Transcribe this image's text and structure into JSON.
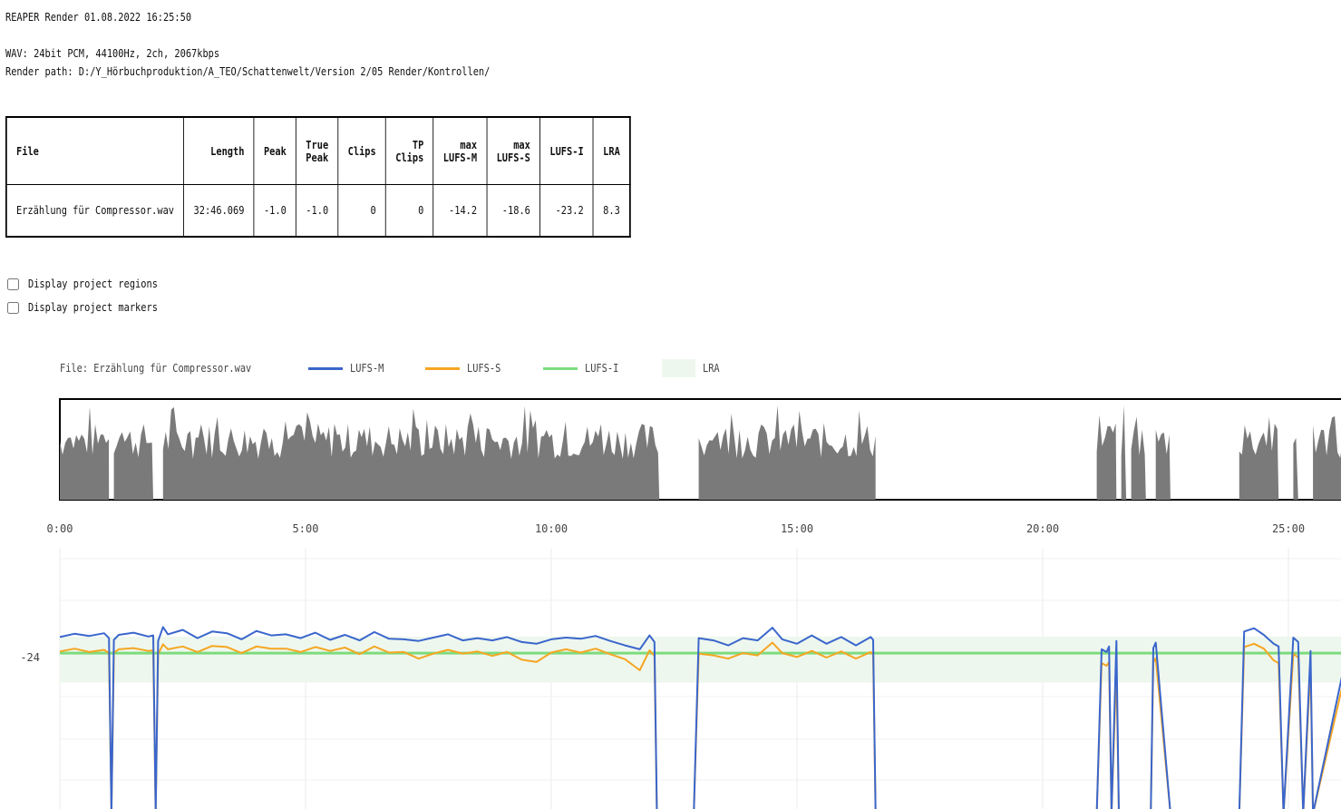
{
  "header": {
    "title": "REAPER Render 01.08.2022 16:25:50",
    "wav_info": "WAV: 24bit PCM, 44100Hz, 2ch, 2067kbps",
    "render_path": "Render path: D:/Y_Hörbuchproduktion/A_TEO/Schattenwelt/Version 2/05 Render/Kontrollen/"
  },
  "table": {
    "headers": [
      "File",
      "Length",
      "Peak",
      "True\nPeak",
      "Clips",
      "TP\nClips",
      "max\nLUFS-M",
      "max\nLUFS-S",
      "LUFS-I",
      "LRA"
    ],
    "rows": [
      [
        "Erzählung für Compressor.wav",
        "32:46.069",
        "-1.0",
        "-1.0",
        "0",
        "0",
        "-14.2",
        "-18.6",
        "-23.2",
        "8.3"
      ]
    ]
  },
  "options": {
    "regions_label": "Display project regions",
    "regions_checked": false,
    "markers_label": "Display project markers",
    "markers_checked": false
  },
  "legend": {
    "file_label": "File: Erzählung für Compressor.wav",
    "lufs_m": "LUFS-M",
    "lufs_s": "LUFS-S",
    "lufs_i": "LUFS-I",
    "lra": "LRA"
  },
  "colors": {
    "lufs_m": "#3a66cc",
    "lufs_s": "#f5a623",
    "lufs_i": "#7ddc7d",
    "lra": "#eef7ee",
    "waveform": "#7a7a7a"
  },
  "chart_data": {
    "type": "line",
    "x_unit": "minutes",
    "xlim": [
      0,
      26.2
    ],
    "x_ticks": [
      "0:00",
      "5:00",
      "10:00",
      "15:00",
      "20:00",
      "25:00"
    ],
    "x_tick_values": [
      0,
      5,
      10,
      15,
      20,
      25
    ],
    "y_ticks": [
      "-24"
    ],
    "y_tick_values": [
      -24
    ],
    "ylim": [
      -40,
      -16
    ],
    "lufs_i": -23.2,
    "lra_range": [
      -28.5,
      -20.2
    ],
    "waveform_segments": [
      [
        0,
        1.0
      ],
      [
        1.1,
        1.9
      ],
      [
        2.1,
        12.2
      ],
      [
        13.0,
        16.6
      ],
      [
        21.1,
        21.5
      ],
      [
        21.6,
        21.7
      ],
      [
        21.8,
        22.1
      ],
      [
        22.3,
        22.6
      ],
      [
        24.0,
        24.8
      ],
      [
        25.1,
        25.2
      ],
      [
        25.5,
        26.2
      ]
    ],
    "series": [
      {
        "name": "LUFS-M",
        "x": [
          0,
          0.3,
          0.6,
          0.9,
          1.0,
          1.05,
          1.1,
          1.2,
          1.5,
          1.8,
          1.9,
          1.95,
          2.0,
          2.1,
          2.2,
          2.5,
          2.8,
          3.1,
          3.4,
          3.7,
          4.0,
          4.3,
          4.6,
          4.9,
          5.2,
          5.5,
          5.8,
          6.1,
          6.4,
          6.7,
          7.0,
          7.3,
          7.6,
          7.9,
          8.2,
          8.5,
          8.8,
          9.1,
          9.4,
          9.7,
          10.0,
          10.3,
          10.6,
          10.9,
          11.2,
          11.5,
          11.8,
          12.0,
          12.1,
          12.15,
          12.2,
          12.9,
          13.0,
          13.3,
          13.6,
          13.9,
          14.2,
          14.5,
          14.7,
          15.0,
          15.3,
          15.6,
          15.9,
          16.2,
          16.5,
          16.55,
          16.6,
          21.1,
          21.2,
          21.3,
          21.35,
          21.4,
          21.5,
          21.55,
          22.2,
          22.25,
          22.3,
          22.6,
          22.65,
          24.0,
          24.1,
          24.3,
          24.5,
          24.7,
          24.8,
          24.9,
          25.1,
          25.2,
          25.3,
          25.45,
          25.5,
          26.2
        ],
        "y": [
          -20.3,
          -19.7,
          -20.1,
          -19.6,
          -20.5,
          -35,
          -20.8,
          -19.9,
          -19.5,
          -20.2,
          -20.0,
          -35,
          -21.0,
          -18.5,
          -19.8,
          -19.0,
          -20.5,
          -19.3,
          -19.6,
          -20.7,
          -19.2,
          -20.0,
          -19.8,
          -20.5,
          -19.5,
          -20.8,
          -19.9,
          -20.9,
          -19.4,
          -20.6,
          -20.7,
          -21.0,
          -20.4,
          -19.8,
          -20.9,
          -20.5,
          -20.9,
          -20.3,
          -21.2,
          -21.5,
          -20.7,
          -20.4,
          -20.6,
          -20.1,
          -21.0,
          -21.8,
          -22.5,
          -20.0,
          -21.2,
          -35,
          -35,
          -35,
          -20.5,
          -20.9,
          -21.8,
          -20.5,
          -20.9,
          -18.6,
          -20.7,
          -21.5,
          -20.0,
          -21.5,
          -20.3,
          -21.8,
          -20.3,
          -20.8,
          -35,
          -35,
          -22.5,
          -23.0,
          -22.0,
          -35,
          -21.0,
          -35,
          -35,
          -22.3,
          -21.3,
          -35,
          -35,
          -35,
          -19.3,
          -18.7,
          -19.9,
          -21.5,
          -22.0,
          -35,
          -20.4,
          -21.2,
          -35,
          -22.8,
          -35,
          -22.8
        ]
      },
      {
        "name": "LUFS-S",
        "x": [
          0,
          0.3,
          0.6,
          0.9,
          1.0,
          1.05,
          1.1,
          1.2,
          1.5,
          1.8,
          1.9,
          1.95,
          2.0,
          2.1,
          2.2,
          2.5,
          2.8,
          3.1,
          3.4,
          3.7,
          4.0,
          4.3,
          4.6,
          4.9,
          5.2,
          5.5,
          5.8,
          6.1,
          6.4,
          6.7,
          7.0,
          7.3,
          7.6,
          7.9,
          8.2,
          8.5,
          8.8,
          9.1,
          9.4,
          9.7,
          10.0,
          10.3,
          10.6,
          10.9,
          11.2,
          11.5,
          11.8,
          12.0,
          12.1,
          12.15,
          12.2,
          12.9,
          13.0,
          13.3,
          13.6,
          13.9,
          14.2,
          14.5,
          14.7,
          15.0,
          15.3,
          15.6,
          15.9,
          16.2,
          16.5,
          16.55,
          16.6,
          21.1,
          21.2,
          21.3,
          21.35,
          21.4,
          21.5,
          21.55,
          22.2,
          22.25,
          22.3,
          22.6,
          22.65,
          24.0,
          24.1,
          24.3,
          24.5,
          24.7,
          24.8,
          24.9,
          25.1,
          25.2,
          25.3,
          25.45,
          25.5,
          26.2
        ],
        "y": [
          -22.9,
          -22.4,
          -23.0,
          -22.6,
          -23.2,
          -35,
          -23.1,
          -22.5,
          -22.3,
          -22.8,
          -22.7,
          -35,
          -23.4,
          -21.6,
          -22.5,
          -22.0,
          -23.0,
          -21.9,
          -22.1,
          -23.2,
          -22.0,
          -22.4,
          -22.4,
          -23.0,
          -22.1,
          -22.8,
          -22.2,
          -23.4,
          -22.0,
          -23.1,
          -23.0,
          -24.2,
          -23.3,
          -22.6,
          -23.3,
          -22.9,
          -23.7,
          -23.0,
          -24.4,
          -24.8,
          -23.1,
          -22.5,
          -23.1,
          -22.4,
          -23.4,
          -24.3,
          -26.3,
          -22.7,
          -23.7,
          -35,
          -35,
          -35,
          -23.3,
          -23.6,
          -24.2,
          -23.2,
          -23.6,
          -21.3,
          -23.2,
          -23.9,
          -22.8,
          -24.0,
          -22.9,
          -24.2,
          -23.0,
          -23.5,
          -35,
          -35,
          -25.0,
          -25.5,
          -24.8,
          -35,
          -25.8,
          -35,
          -35,
          -24.9,
          -24.1,
          -35,
          -35,
          -35,
          -22.1,
          -21.5,
          -22.4,
          -24.5,
          -25.0,
          -35,
          -23.3,
          -24.0,
          -35,
          -25.4,
          -35,
          -25.3
        ]
      }
    ]
  }
}
